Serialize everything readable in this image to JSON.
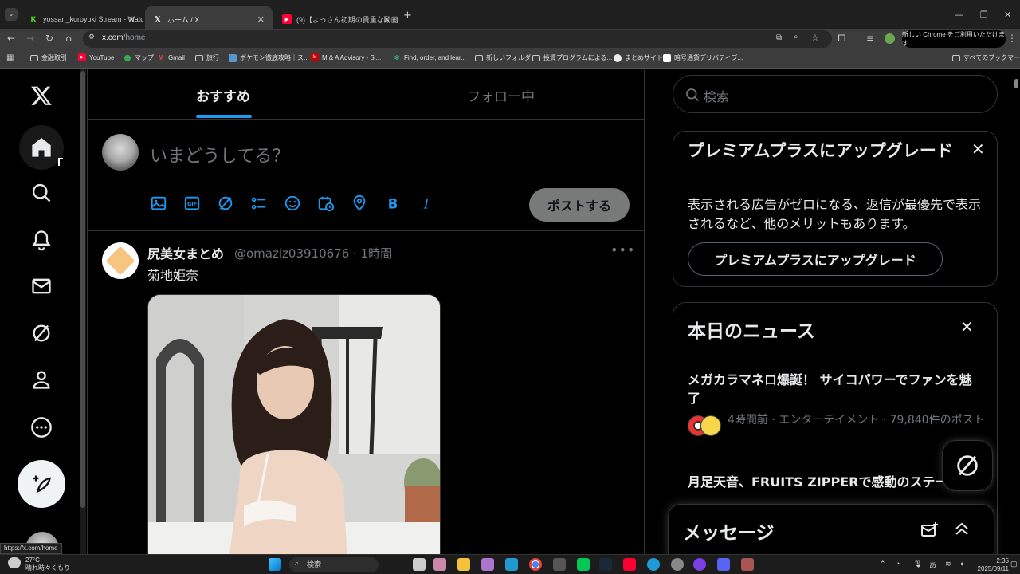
{
  "browser": {
    "tabs": [
      {
        "title": "yossan_kuroyuki Stream - Watc",
        "favicon": "kick-icon",
        "color": "#53fc18"
      },
      {
        "title": "ホーム / X",
        "favicon": "x-icon",
        "color": "#ffffff"
      },
      {
        "title": "(9)【よっさん初期の貴重な動画◎",
        "favicon": "youtube-icon",
        "color": "#ff0033"
      }
    ],
    "new_tab": "+",
    "url_host": "x.com",
    "url_path": "/home",
    "chrome_promo": "新しい Chrome をご利用いただけます",
    "bookmarks": [
      "金融取引",
      "YouTube",
      "マップ",
      "Gmail",
      "旅行",
      "ポケモン徹底攻略｜ス...",
      "M & A Advisory - Si...",
      "Find, order, and lear...",
      "新しいフォルダ",
      "投資プログラムによる...",
      "まとめサイト",
      "暗号通貨デリバティブ..."
    ],
    "all_bookmarks": "すべてのブックマーク",
    "status_url": "https://x.com/home"
  },
  "x": {
    "tabs": {
      "for_you": "おすすめ",
      "following": "フォロー中"
    },
    "composer": {
      "placeholder": "いまどうしてる？",
      "post_button": "ポストする"
    },
    "tweet": {
      "name": "尻美女まとめ",
      "handle": "@omaziz03910676 · 1時間",
      "text": "菊地姫奈"
    },
    "search_placeholder": "検索",
    "premium": {
      "title": "プレミアムプラスにアップグレード",
      "description": "表示される広告がゼロになる、返信が最優先で表示されるなど、他のメリットもあります。",
      "button": "プレミアムプラスにアップグレード"
    },
    "news": {
      "title": "本日のニュース",
      "items": [
        {
          "headline": "メガカラマネロ爆誕！ サイコパワーでファンを魅了",
          "meta": "4時間前 · エンターテイメント · 79,840件のポスト"
        },
        {
          "headline": "月足天音、FRUITS ZIPPERで感動のステージ帰"
        }
      ]
    },
    "messages_title": "メッセージ"
  },
  "taskbar": {
    "weather_temp": "27°C",
    "weather_desc": "晴れ時々くもり",
    "search": "検索",
    "ime": "あ",
    "time": "2:35",
    "date": "2025/09/11"
  },
  "colors": {
    "accent": "#1d9bf0",
    "background": "#000000",
    "border": "#2f3336",
    "muted": "#71767b"
  }
}
